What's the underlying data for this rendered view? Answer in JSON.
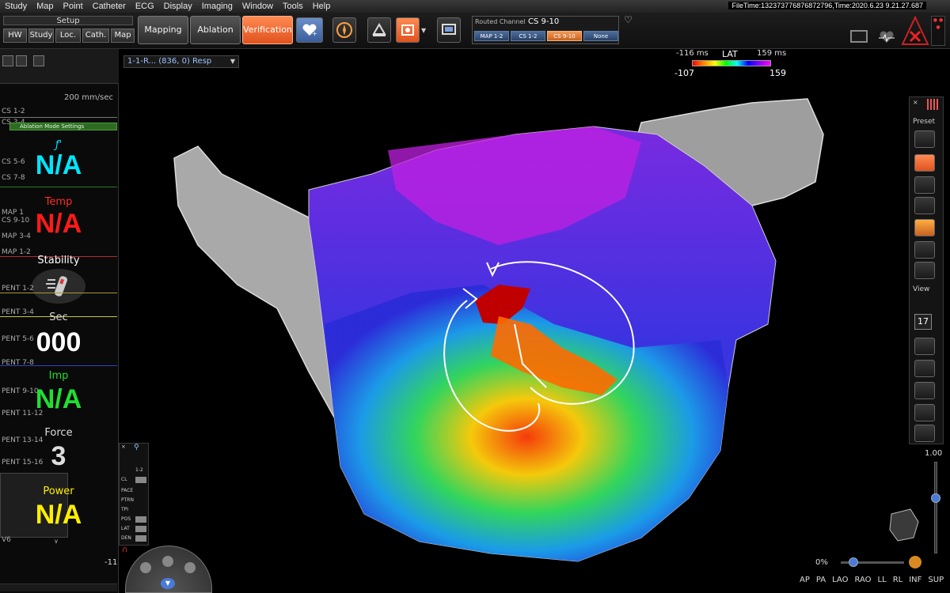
{
  "menu": [
    "Study",
    "Map",
    "Point",
    "Catheter",
    "ECG",
    "Display",
    "Imaging",
    "Window",
    "Tools",
    "Help"
  ],
  "filetime": "FileTime:132373776876872796,Time:2020.6.23 9.21.27.687",
  "setup": {
    "label": "Setup",
    "buttons": [
      "HW",
      "Study",
      "Loc.",
      "Cath.",
      "Map"
    ]
  },
  "modes": {
    "mapping": "Mapping",
    "ablation": "Ablation",
    "verification": "Verification"
  },
  "channel": {
    "title": "Routed Channel",
    "value": "CS 9-10",
    "buttons": [
      "MAP 1-2",
      "CS 1-2",
      "CS 9-10",
      "None"
    ]
  },
  "map_select": "1-1-R... (836, 0) Resp",
  "lat": {
    "title": "LAT",
    "min_ms": "-116 ms",
    "max_ms": "159 ms",
    "low": "-107",
    "high": "159"
  },
  "left_panel": {
    "speed": "200 mm/sec",
    "traces": [
      "CS 1-2",
      "CS 3-4",
      "CS 5-6",
      "CS 7-8",
      "MAP 1",
      "CS 9-10",
      "MAP 3-4",
      "MAP 1-2",
      "PENT 1-2",
      "PENT 3-4",
      "PENT 5-6",
      "PENT 7-8",
      "PENT 9-10",
      "PENT 11-12",
      "PENT 13-14",
      "PENT 15-16",
      "V6"
    ],
    "ablation_settings": "Ablation Mode Settings",
    "f_label": "ƒ'",
    "f_value": "N/A",
    "temp_label": "Temp",
    "temp_value": "N/A",
    "stability_label": "Stability",
    "sec_label": "Sec",
    "sec_value": "000",
    "imp_label": "Imp",
    "imp_value": "N/A",
    "force_label": "Force",
    "force_value": "3",
    "power_label": "Power",
    "power_value": "N/A",
    "bottom_value": "-11"
  },
  "right_panel": {
    "preset": "Preset",
    "view": "View",
    "view_number": "17"
  },
  "mini_panel": {
    "header": "1-2",
    "labels": [
      "CL",
      "PACE",
      "PTRN",
      "TPI",
      "POS",
      "LAT",
      "DEN"
    ]
  },
  "zoom": "1.00",
  "zoom_percent": "0%",
  "views": [
    "AP",
    "PA",
    "LAO",
    "RAO",
    "LL",
    "RL",
    "INF",
    "SUP"
  ],
  "colors": {
    "accent_orange": "#ff7a3d",
    "ablation_na_red": "#ff1a1a",
    "f_cyan": "#00e5ff",
    "imp_green": "#22dd33",
    "power_yellow": "#ffee00"
  }
}
